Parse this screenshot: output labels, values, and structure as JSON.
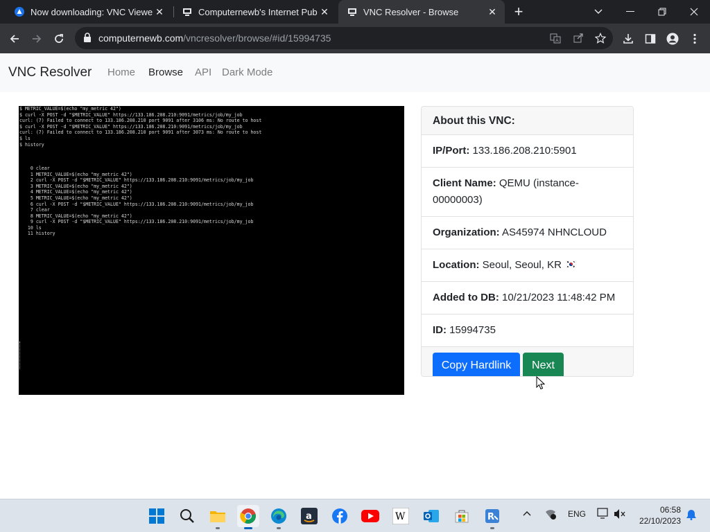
{
  "browser": {
    "tabs": [
      {
        "title": "Now downloading: VNC Viewer",
        "icon": "vnc-icon"
      },
      {
        "title": "Computernewb's Internet Pub H",
        "icon": "computernewb-icon"
      },
      {
        "title": "VNC Resolver - Browse",
        "icon": "computernewb-icon"
      }
    ],
    "url_host": "computernewb.com",
    "url_path": "/vncresolver/browse/#id/15994735"
  },
  "navbar": {
    "brand": "VNC Resolver",
    "links": [
      "Home",
      "Browse",
      "API",
      "Dark Mode"
    ],
    "active": "Browse"
  },
  "screenshot": {
    "lines": [
      "$ METRIC_VALUE=$(echo \"my_metric 42\")",
      "$ curl -X POST -d \"$METRIC_VALUE\" https://133.186.208.210:9091/metrics/job/my_job",
      "curl: (7) Failed to connect to 133.186.208.210 port 9091 after 3106 ms: No route to host",
      "$ curl -X POST -d \"$METRIC_VALUE\" https://133.186.208.210:9091/metrics/job/my_job",
      "curl: (7) Failed to connect to 133.186.208.210 port 9091 after 3073 ms: No route to host",
      "$ ls",
      "$ history",
      "",
      "",
      "",
      "    0 clear",
      "    1 METRIC_VALUE=$(echo \"my_metric 42\")",
      "    2 curl -X POST -d \"$METRIC_VALUE\" https://133.186.208.210:9091/metrics/job/my_job",
      "    3 METRIC_VALUE=$(echo \"my_metric 42\")",
      "    4 METRIC_VALUE=$(echo \"my_metric 42\")",
      "    5 METRIC_VALUE=$(echo \"my_metric 42\")",
      "    6 curl -X POST -d \"$METRIC_VALUE\" https://133.186.208.210:9091/metrics/job/my_job",
      "    7 clear",
      "    8 METRIC_VALUE=$(echo \"my_metric 42\")",
      "    9 curl -X POST -d \"$METRIC_VALUE\" https://133.186.208.210:9091/metrics/job/my_job",
      "   10 ls",
      "   11 history"
    ]
  },
  "card": {
    "header": "About this VNC:",
    "ip_label": "IP/Port:",
    "ip_value": "133.186.208.210:5901",
    "client_label": "Client Name:",
    "client_value": "QEMU (instance-00000003)",
    "org_label": "Organization:",
    "org_value": "AS45974 NHNCLOUD",
    "location_label": "Location:",
    "location_value": "Seoul, Seoul, KR",
    "added_label": "Added to DB:",
    "added_value": "10/21/2023 11:48:42 PM",
    "id_label": "ID:",
    "id_value": "15994735",
    "copy_button": "Copy Hardlink",
    "next_button": "Next"
  },
  "taskbar": {
    "apps": [
      "start-icon",
      "search-icon",
      "file-explorer-icon",
      "chrome-icon",
      "edge-icon",
      "amazon-icon",
      "facebook-icon",
      "youtube-icon",
      "wikipedia-icon",
      "outlook-icon",
      "microsoft-store-icon",
      "remote-desktop-icon"
    ],
    "language": "ENG",
    "time": "06:58",
    "date": "22/10/2023"
  },
  "colors": {
    "primary": "#0d6efd",
    "success": "#198754",
    "chrome_dark": "#202124"
  }
}
